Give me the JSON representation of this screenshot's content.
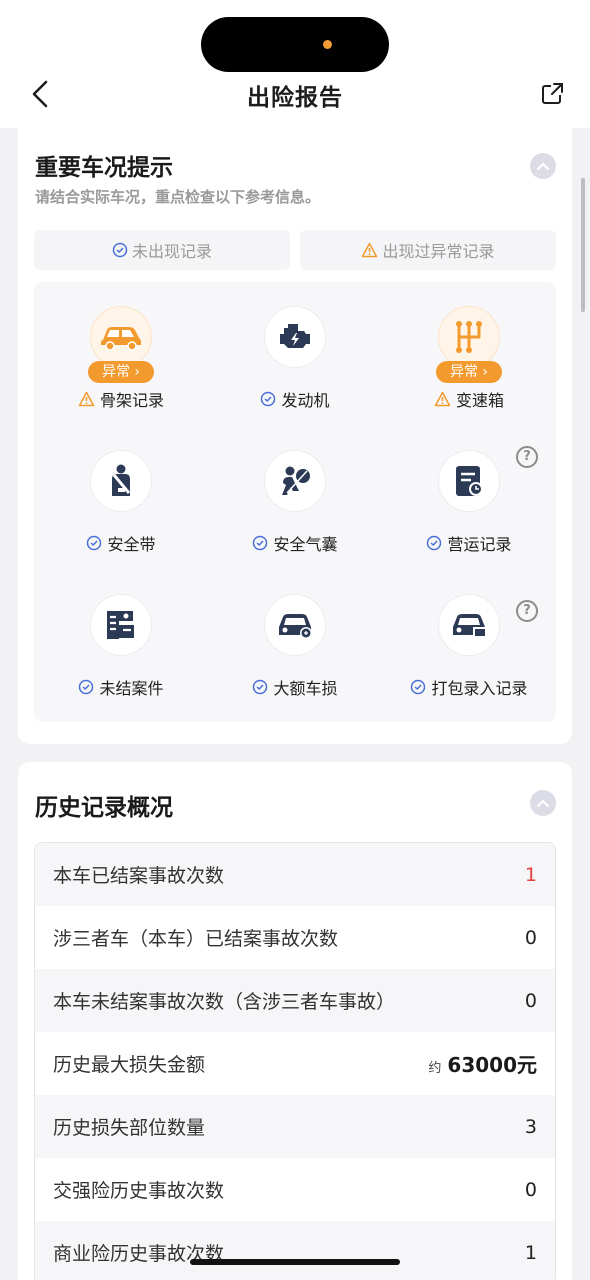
{
  "nav": {
    "title": "出险报告"
  },
  "card1": {
    "title": "重要车况提示",
    "subtitle": "请结合实际车况，重点检查以下参考信息。",
    "legend_ok": "未出现记录",
    "legend_warn": "出现过异常记录",
    "abnormal_badge": "异常",
    "items": [
      {
        "label": "骨架记录",
        "status": "warning",
        "icon": "car-frame-icon"
      },
      {
        "label": "发动机",
        "status": "ok",
        "icon": "engine-icon"
      },
      {
        "label": "变速箱",
        "status": "warning",
        "icon": "gearbox-icon"
      },
      {
        "label": "安全带",
        "status": "ok",
        "icon": "seatbelt-icon"
      },
      {
        "label": "安全气囊",
        "status": "ok",
        "icon": "airbag-icon"
      },
      {
        "label": "营运记录",
        "status": "ok",
        "icon": "operation-record-icon"
      },
      {
        "label": "未结案件",
        "status": "ok",
        "icon": "open-case-icon"
      },
      {
        "label": "大额车损",
        "status": "ok",
        "icon": "major-damage-icon"
      },
      {
        "label": "打包录入记录",
        "status": "ok",
        "icon": "bundle-record-icon"
      }
    ]
  },
  "card2": {
    "title": "历史记录概况",
    "rows": [
      {
        "label": "本车已结案事故次数",
        "value": "1"
      },
      {
        "label": "涉三者车（本车）已结案事故次数",
        "value": "0"
      },
      {
        "label": "本车未结案事故次数（含涉三者车事故）",
        "value": "0"
      },
      {
        "label": "历史最大损失金额",
        "prefix": "约",
        "value": "63000元"
      },
      {
        "label": "历史损失部位数量",
        "value": "3"
      },
      {
        "label": "交强险历史事故次数",
        "value": "0"
      },
      {
        "label": "商业险历史事故次数",
        "value": "1"
      }
    ]
  },
  "colors": {
    "accent_orange": "#f39a2f",
    "ok_blue": "#4a6fd8",
    "danger_red": "#e04040"
  }
}
